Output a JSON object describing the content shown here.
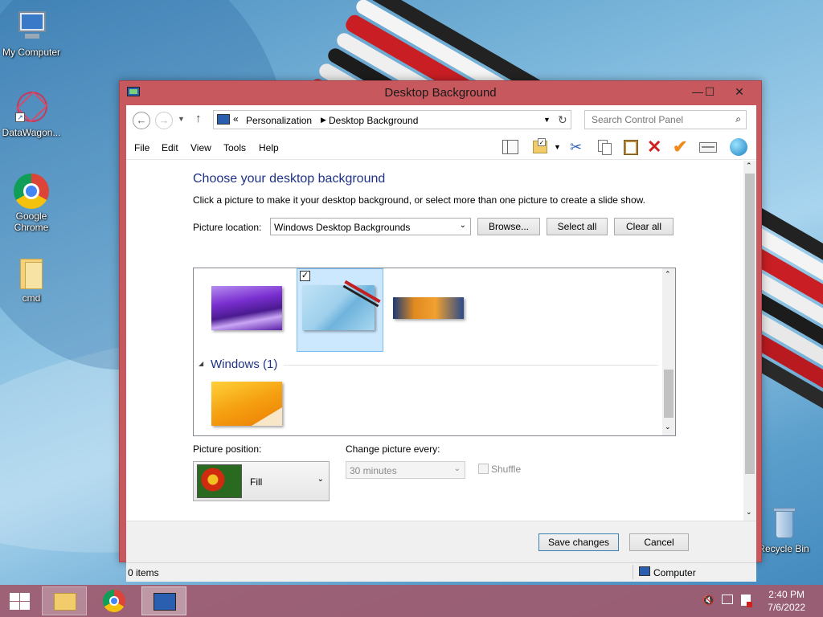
{
  "desktop": {
    "icons": [
      {
        "label": "My Computer"
      },
      {
        "label": "DataWagon..."
      },
      {
        "label": "Google Chrome"
      },
      {
        "label": "cmd"
      },
      {
        "label": "Recycle Bin"
      }
    ]
  },
  "window": {
    "title": "Desktop Background",
    "buttons": {
      "minimize": "—",
      "maximize": "☐",
      "close": "✕"
    }
  },
  "address": {
    "prefix": "«",
    "crumbs": [
      "Personalization",
      "Desktop Background"
    ],
    "search_placeholder": "Search Control Panel"
  },
  "menu": [
    "File",
    "Edit",
    "View",
    "Tools",
    "Help"
  ],
  "main": {
    "heading": "Choose your desktop background",
    "subtitle": "Click a picture to make it your desktop background, or select more than one picture to create a slide show.",
    "picture_location_label": "Picture location:",
    "picture_location_value": "Windows Desktop Backgrounds",
    "browse_label": "Browse...",
    "select_all_label": "Select all",
    "clear_all_label": "Clear all",
    "group_label": "Windows (1)",
    "picture_position_label": "Picture position:",
    "picture_position_value": "Fill",
    "change_every_label": "Change picture every:",
    "change_every_value": "30 minutes",
    "shuffle_label": "Shuffle"
  },
  "footer": {
    "save_label": "Save changes",
    "cancel_label": "Cancel"
  },
  "status": {
    "items": "0 items",
    "zone": "Computer"
  },
  "taskbar": {
    "time": "2:40 PM",
    "date": "7/6/2022"
  }
}
